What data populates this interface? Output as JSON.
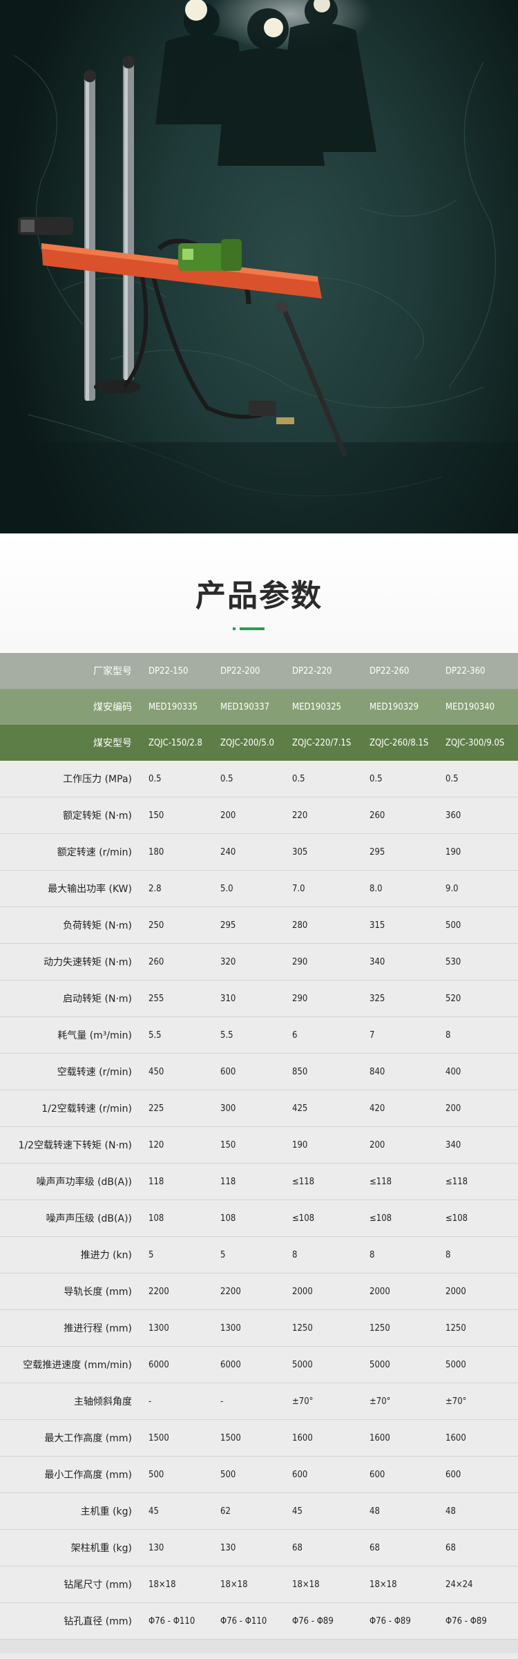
{
  "section": {
    "title": "产品参数"
  },
  "colors": {
    "accent": "#2f9b4c",
    "header1": "#a6ada3",
    "header2": "#879f76",
    "header3": "#5e7e47"
  },
  "spec_table": {
    "header_rows": [
      {
        "label": "厂家型号",
        "values": [
          "DP22-150",
          "DP22-200",
          "DP22-220",
          "DP22-260",
          "DP22-360"
        ]
      },
      {
        "label": "煤安编码",
        "values": [
          "MED190335",
          "MED190337",
          "MED190325",
          "MED190329",
          "MED190340"
        ]
      },
      {
        "label": "煤安型号",
        "values": [
          "ZQJC-150/2.8",
          "ZQJC-200/5.0",
          "ZQJC-220/7.1S",
          "ZQJC-260/8.1S",
          "ZQJC-300/9.0S"
        ]
      }
    ],
    "rows": [
      {
        "label": "工作压力 (MPa)",
        "values": [
          "0.5",
          "0.5",
          "0.5",
          "0.5",
          "0.5"
        ]
      },
      {
        "label": "额定转矩 (N·m)",
        "values": [
          "150",
          "200",
          "220",
          "260",
          "360"
        ]
      },
      {
        "label": "额定转速 (r/min)",
        "values": [
          "180",
          "240",
          "305",
          "295",
          "190"
        ]
      },
      {
        "label": "最大输出功率 (KW)",
        "values": [
          "2.8",
          "5.0",
          "7.0",
          "8.0",
          "9.0"
        ]
      },
      {
        "label": "负荷转矩 (N·m)",
        "values": [
          "250",
          "295",
          "280",
          "315",
          "500"
        ]
      },
      {
        "label": "动力失速转矩 (N·m)",
        "values": [
          "260",
          "320",
          "290",
          "340",
          "530"
        ]
      },
      {
        "label": "启动转矩 (N·m)",
        "values": [
          "255",
          "310",
          "290",
          "325",
          "520"
        ]
      },
      {
        "label": "耗气量 (m³/min)",
        "values": [
          "5.5",
          "5.5",
          "6",
          "7",
          "8"
        ]
      },
      {
        "label": "空载转速 (r/min)",
        "values": [
          "450",
          "600",
          "850",
          "840",
          "400"
        ]
      },
      {
        "label": "1/2空载转速 (r/min)",
        "values": [
          "225",
          "300",
          "425",
          "420",
          "200"
        ]
      },
      {
        "label": "1/2空载转速下转矩 (N·m)",
        "values": [
          "120",
          "150",
          "190",
          "200",
          "340"
        ]
      },
      {
        "label": "噪声声功率级 (dB(A))",
        "values": [
          "118",
          "118",
          "≤118",
          "≤118",
          "≤118"
        ]
      },
      {
        "label": "噪声声压级 (dB(A))",
        "values": [
          "108",
          "108",
          "≤108",
          "≤108",
          "≤108"
        ]
      },
      {
        "label": "推进力 (kn)",
        "values": [
          "5",
          "5",
          "8",
          "8",
          "8"
        ]
      },
      {
        "label": "导轨长度 (mm)",
        "values": [
          "2200",
          "2200",
          "2000",
          "2000",
          "2000"
        ]
      },
      {
        "label": "推进行程 (mm)",
        "values": [
          "1300",
          "1300",
          "1250",
          "1250",
          "1250"
        ]
      },
      {
        "label": "空载推进速度 (mm/min)",
        "values": [
          "6000",
          "6000",
          "5000",
          "5000",
          "5000"
        ]
      },
      {
        "label": "主轴倾斜角度",
        "values": [
          "-",
          "-",
          "±70°",
          "±70°",
          "±70°"
        ]
      },
      {
        "label": "最大工作高度 (mm)",
        "values": [
          "1500",
          "1500",
          "1600",
          "1600",
          "1600"
        ]
      },
      {
        "label": "最小工作高度 (mm)",
        "values": [
          "500",
          "500",
          "600",
          "600",
          "600"
        ]
      },
      {
        "label": "主机重 (kg)",
        "values": [
          "45",
          "62",
          "45",
          "48",
          "48"
        ]
      },
      {
        "label": "架柱机重 (kg)",
        "values": [
          "130",
          "130",
          "68",
          "68",
          "68"
        ]
      },
      {
        "label": "钻尾尺寸 (mm)",
        "values": [
          "18×18",
          "18×18",
          "18×18",
          "18×18",
          "24×24"
        ]
      },
      {
        "label": "钻孔直径 (mm)",
        "values": [
          "Φ76 - Φ110",
          "Φ76 - Φ110",
          "Φ76 - Φ89",
          "Φ76 - Φ89",
          "Φ76 - Φ89"
        ]
      }
    ]
  }
}
